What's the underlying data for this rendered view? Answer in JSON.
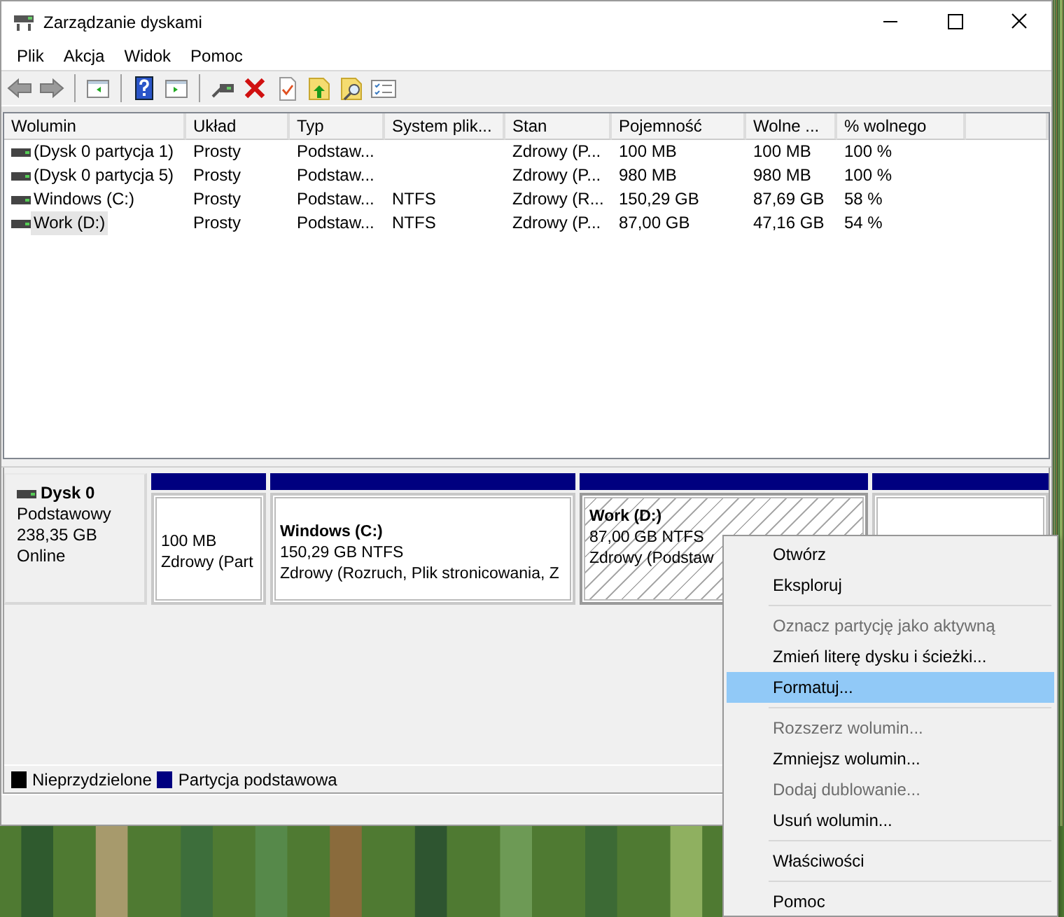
{
  "window": {
    "title": "Zarządzanie dyskami"
  },
  "menu": [
    "Plik",
    "Akcja",
    "Widok",
    "Pomoc"
  ],
  "table": {
    "columns": [
      "Wolumin",
      "Układ",
      "Typ",
      "System plik...",
      "Stan",
      "Pojemność",
      "Wolne ...",
      "% wolnego"
    ],
    "rows": [
      {
        "cells": [
          "(Dysk 0 partycja 1)",
          "Prosty",
          "Podstaw...",
          "",
          "Zdrowy (P...",
          "100 MB",
          "100 MB",
          "100 %"
        ],
        "selected": false
      },
      {
        "cells": [
          "(Dysk 0 partycja 5)",
          "Prosty",
          "Podstaw...",
          "",
          "Zdrowy (P...",
          "980 MB",
          "980 MB",
          "100 %"
        ],
        "selected": false
      },
      {
        "cells": [
          "Windows (C:)",
          "Prosty",
          "Podstaw...",
          "NTFS",
          "Zdrowy (R...",
          "150,29 GB",
          "87,69 GB",
          "58 %"
        ],
        "selected": false
      },
      {
        "cells": [
          "Work (D:)",
          "Prosty",
          "Podstaw...",
          "NTFS",
          "Zdrowy (P...",
          "87,00 GB",
          "47,16 GB",
          "54 %"
        ],
        "selected": true
      }
    ]
  },
  "disk": {
    "name": "Dysk 0",
    "type": "Podstawowy",
    "size": "238,35 GB",
    "status": "Online",
    "partitions": [
      {
        "kind": "primary",
        "selected": false,
        "size": "100 MB",
        "status": "Zdrowy (Part"
      },
      {
        "kind": "primary",
        "selected": false,
        "name": "Windows  (C:)",
        "size": "150,29 GB NTFS",
        "status": "Zdrowy (Rozruch, Plik stronicowania, Z"
      },
      {
        "kind": "primary",
        "selected": true,
        "name": "Work  (D:)",
        "size": "87,00 GB NTFS",
        "status": "Zdrowy (Podstaw"
      },
      {
        "kind": "primary",
        "selected": false
      }
    ]
  },
  "legend": [
    {
      "label": "Nieprzydzielone",
      "color": "#000000"
    },
    {
      "label": "Partycja podstawowa",
      "color": "#000080"
    }
  ],
  "context_menu": [
    {
      "kind": "item",
      "label": "Otwórz",
      "disabled": false,
      "selected": false
    },
    {
      "kind": "item",
      "label": "Eksploruj",
      "disabled": false,
      "selected": false
    },
    {
      "kind": "separator"
    },
    {
      "kind": "item",
      "label": "Oznacz partycję jako aktywną",
      "disabled": true,
      "selected": false
    },
    {
      "kind": "item",
      "label": "Zmień literę dysku i ścieżki...",
      "disabled": false,
      "selected": false
    },
    {
      "kind": "item",
      "label": "Formatuj...",
      "disabled": false,
      "selected": true
    },
    {
      "kind": "separator"
    },
    {
      "kind": "item",
      "label": "Rozszerz wolumin...",
      "disabled": true,
      "selected": false
    },
    {
      "kind": "item",
      "label": "Zmniejsz wolumin...",
      "disabled": false,
      "selected": false
    },
    {
      "kind": "item",
      "label": "Dodaj dublowanie...",
      "disabled": true,
      "selected": false
    },
    {
      "kind": "item",
      "label": "Usuń wolumin...",
      "disabled": false,
      "selected": false
    },
    {
      "kind": "separator"
    },
    {
      "kind": "item",
      "label": "Właściwości",
      "disabled": false,
      "selected": false
    },
    {
      "kind": "separator"
    },
    {
      "kind": "item",
      "label": "Pomoc",
      "disabled": false,
      "selected": false
    }
  ]
}
